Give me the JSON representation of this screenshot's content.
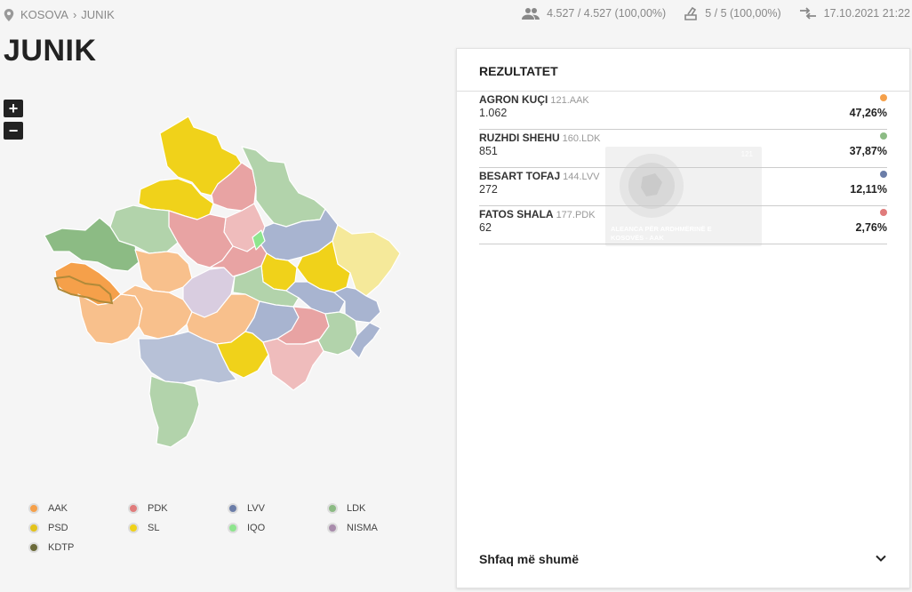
{
  "breadcrumb": {
    "country": "KOSOVA",
    "municipality": "JUNIK"
  },
  "stats": {
    "voters": "4.527 / 4.527 (100,00%)",
    "stations": "5 / 5 (100,00%)",
    "updated": "17.10.2021 21:22"
  },
  "page_title": "JUNIK",
  "zoom": {
    "in": "+",
    "out": "−"
  },
  "panel": {
    "title": "REZULTATET",
    "show_more": "Shfaq më shumë",
    "watermark": {
      "number": "121",
      "text": "ALEANCA PËR ARDHMËRINË E KOSOVËS - AAK"
    },
    "candidates": [
      {
        "name": "AGRON KUÇI",
        "code": "121.AAK",
        "votes": "1.062",
        "percent": "47,26%",
        "color": "#f5a04a"
      },
      {
        "name": "RUZHDI SHEHU",
        "code": "160.LDK",
        "votes": "851",
        "percent": "37,87%",
        "color": "#8cbb84"
      },
      {
        "name": "BESART TOFAJ",
        "code": "144.LVV",
        "votes": "272",
        "percent": "12,11%",
        "color": "#6b7da8"
      },
      {
        "name": "FATOS SHALA",
        "code": "177.PDK",
        "votes": "62",
        "percent": "2,76%",
        "color": "#e07b7b"
      }
    ]
  },
  "legend": [
    {
      "label": "AAK",
      "color": "#f5a04a"
    },
    {
      "label": "PDK",
      "color": "#e07b7b"
    },
    {
      "label": "LVV",
      "color": "#6b7da8"
    },
    {
      "label": "LDK",
      "color": "#8cbb84"
    },
    {
      "label": "PSD",
      "color": "#e3c31b"
    },
    {
      "label": "SL",
      "color": "#f0d21a"
    },
    {
      "label": "IQO",
      "color": "#8ee58e"
    },
    {
      "label": "NISMA",
      "color": "#a98cac"
    },
    {
      "label": "KDTP",
      "color": "#6b6a3a"
    }
  ]
}
